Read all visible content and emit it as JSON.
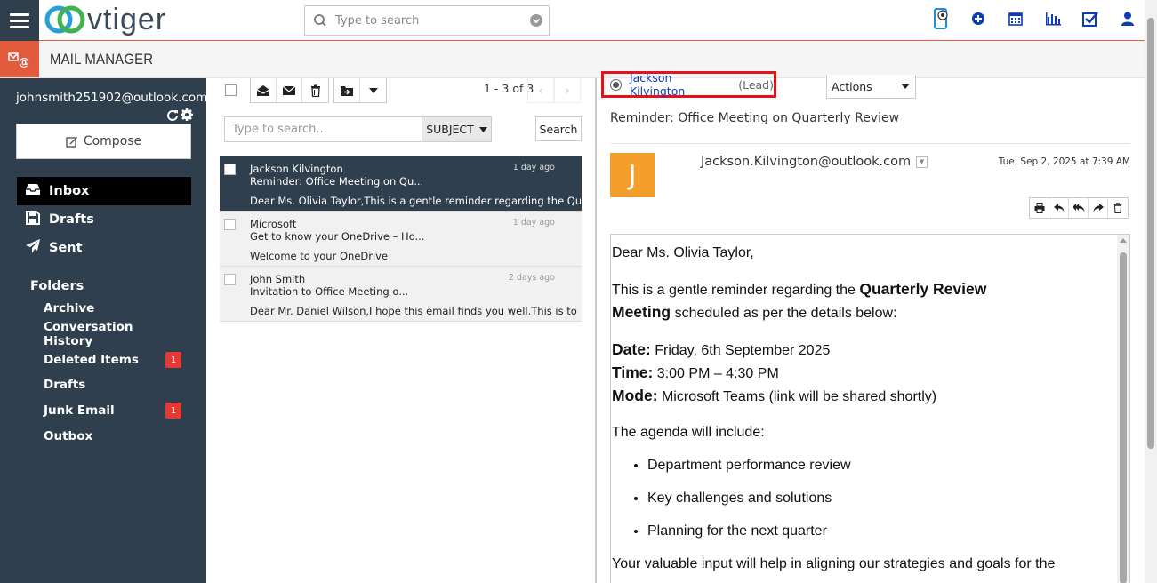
{
  "topbar": {
    "logo_text": "vtiger",
    "search_placeholder": "Type to search",
    "icons": [
      "announcement-icon",
      "quick-create-icon",
      "calendar-icon",
      "reports-icon",
      "tasks-icon",
      "user-icon"
    ]
  },
  "module": {
    "title": "MAIL MANAGER",
    "icon_text": "@"
  },
  "sidebar": {
    "account": "johnsmith251902@outlook.com",
    "compose_label": "Compose",
    "main_folders": [
      {
        "label": "Inbox",
        "active": true
      },
      {
        "label": "Drafts",
        "active": false
      },
      {
        "label": "Sent",
        "active": false
      }
    ],
    "folders_heading": "Folders",
    "folders": [
      {
        "label": "Archive",
        "badge": ""
      },
      {
        "label": "Conversation History",
        "badge": ""
      },
      {
        "label": "Deleted Items",
        "badge": "1"
      },
      {
        "label": "Drafts",
        "badge": ""
      },
      {
        "label": "Junk Email",
        "badge": "1"
      },
      {
        "label": "Outbox",
        "badge": ""
      }
    ]
  },
  "list": {
    "page_info": "1 - 3 of 3",
    "search_placeholder": "Type to search...",
    "search_field": "SUBJECT",
    "search_button": "Search",
    "messages": [
      {
        "from": "Jackson Kilvington",
        "subject": "Reminder: Office Meeting on Qu...",
        "preview": "Dear Ms. Olivia Taylor,This is a gentle reminder regarding the Quarterly",
        "date": "1 day ago",
        "selected": true
      },
      {
        "from": "Microsoft",
        "subject": "Get to know your OneDrive – Ho...",
        "preview": "Welcome to your OneDrive",
        "date": "1 day ago",
        "selected": false
      },
      {
        "from": "John Smith",
        "subject": "Invitation to Office Meeting o...",
        "preview": "Dear Mr. Daniel Wilson,I hope this email finds you well.This is to inform",
        "date": "2 days ago",
        "selected": false
      }
    ]
  },
  "reader": {
    "linked_record": "Jackson Kilvington",
    "linked_type": "(Lead)",
    "actions_label": "Actions",
    "subject": "Reminder: Office Meeting on Quarterly Review",
    "avatar_letter": "J",
    "from": "Jackson.Kilvington@outlook.com",
    "date": "Tue, Sep 2, 2025 at 7:39 AM",
    "body": {
      "greeting": "Dear Ms. Olivia Taylor,",
      "intro_before": "This is a gentle reminder regarding the ",
      "intro_bold": "Quarterly Review Meeting",
      "intro_after": " scheduled as per the details below:",
      "date_label": "Date:",
      "date_value": " Friday, 6th September 2025",
      "time_label": "Time:",
      "time_value": " 3:00 PM – 4:30 PM",
      "mode_label": "Mode:",
      "mode_value": " Microsoft Teams (link will be shared shortly)",
      "agenda_intro": "The agenda will include:",
      "agenda": [
        "Department performance review",
        "Key challenges and solutions",
        "Planning for the next quarter"
      ],
      "closing": "Your valuable input will help in aligning our strategies and goals for the"
    }
  }
}
